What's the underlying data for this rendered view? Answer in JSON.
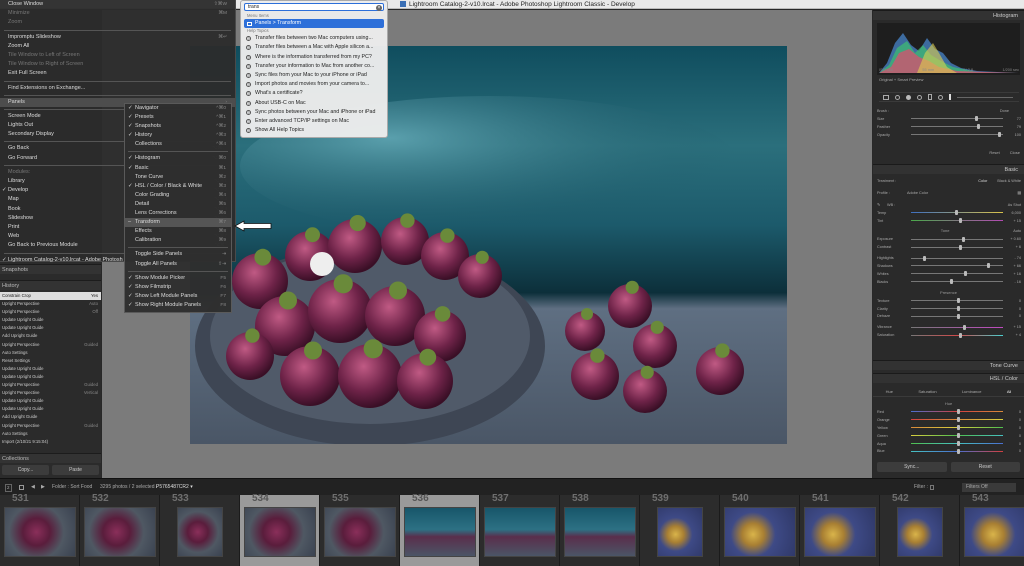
{
  "window": {
    "title": "Lightroom Catalog-2-v10.lrcat - Adobe Photoshop Lightroom Classic - Develop"
  },
  "colors": {
    "accent": "#2d6fd9",
    "panel": "#2b2b2b",
    "selected_row": "#dcdcdc"
  },
  "menu": {
    "items": [
      {
        "label": "Close Window",
        "shortcut": "⇧⌘W",
        "disabled": false
      },
      {
        "label": "Minimize",
        "shortcut": "⌘M",
        "disabled": true
      },
      {
        "label": "Zoom",
        "shortcut": "",
        "disabled": true
      },
      {
        "sep": true
      },
      {
        "label": "Impromptu Slideshow",
        "shortcut": "⌘↵",
        "disabled": false
      },
      {
        "label": "Zoom All",
        "shortcut": "",
        "disabled": false
      },
      {
        "label": "Tile Window to Left of Screen",
        "shortcut": "",
        "disabled": true
      },
      {
        "label": "Tile Window to Right of Screen",
        "shortcut": "",
        "disabled": true
      },
      {
        "label": "Exit Full Screen",
        "shortcut": "",
        "disabled": false
      },
      {
        "sep": true
      },
      {
        "label": "Find Extensions on Exchange...",
        "shortcut": "",
        "disabled": false
      },
      {
        "sep": true
      },
      {
        "label": "Panels",
        "shortcut": "›",
        "disabled": false,
        "highlight": true
      },
      {
        "sep": true
      },
      {
        "label": "Screen Mode",
        "shortcut": "›",
        "disabled": false
      },
      {
        "label": "Lights Out",
        "shortcut": "›",
        "disabled": false
      },
      {
        "label": "Secondary Display",
        "shortcut": "›",
        "disabled": false
      },
      {
        "sep": true
      },
      {
        "label": "Go Back",
        "shortcut": "⌥⌘←",
        "disabled": false
      },
      {
        "label": "Go Forward",
        "shortcut": "⌥⌘→",
        "disabled": false
      },
      {
        "sep": true
      },
      {
        "label": "Modules:",
        "shortcut": "",
        "disabled": true
      },
      {
        "label": "Library",
        "shortcut": "⌥⌘1",
        "disabled": false
      },
      {
        "label": "Develop",
        "shortcut": "⌥⌘2",
        "disabled": false,
        "check": true
      },
      {
        "label": "Map",
        "shortcut": "⌥⌘3",
        "disabled": false
      },
      {
        "label": "Book",
        "shortcut": "⌥⌘4",
        "disabled": false
      },
      {
        "label": "Slideshow",
        "shortcut": "⌥⌘5",
        "disabled": false
      },
      {
        "label": "Print",
        "shortcut": "⌥⌘6",
        "disabled": false
      },
      {
        "label": "Web",
        "shortcut": "⌥⌘7",
        "disabled": false
      },
      {
        "label": "Go Back to Previous Module",
        "shortcut": "⌥⌘↑",
        "disabled": false
      },
      {
        "sep": true
      },
      {
        "label": "Lightroom Catalog-2-v10.lrcat - Adobe Photosh",
        "shortcut": "",
        "disabled": false,
        "check": true
      }
    ]
  },
  "submenu": {
    "items": [
      {
        "label": "Navigator",
        "shortcut": "^⌘0",
        "check": true
      },
      {
        "label": "Presets",
        "shortcut": "^⌘1",
        "check": true
      },
      {
        "label": "Snapshots",
        "shortcut": "^⌘2",
        "check": true
      },
      {
        "label": "History",
        "shortcut": "^⌘3",
        "check": true
      },
      {
        "label": "Collections",
        "shortcut": "^⌘4",
        "check": false
      },
      {
        "sep": true
      },
      {
        "label": "Histogram",
        "shortcut": "⌘0",
        "check": true
      },
      {
        "label": "Basic",
        "shortcut": "⌘1",
        "check": true
      },
      {
        "label": "Tone Curve",
        "shortcut": "⌘2",
        "check": false
      },
      {
        "label": "HSL / Color / Black & White",
        "shortcut": "⌘3",
        "check": true
      },
      {
        "label": "Color Grading",
        "shortcut": "⌘4",
        "check": false
      },
      {
        "label": "Detail",
        "shortcut": "⌘5",
        "check": false
      },
      {
        "label": "Lens Corrections",
        "shortcut": "⌘6",
        "check": false
      },
      {
        "label": "Transform",
        "shortcut": "⌘7",
        "check": false,
        "dash": true,
        "highlight": true
      },
      {
        "label": "Effects",
        "shortcut": "⌘8",
        "check": false
      },
      {
        "label": "Calibration",
        "shortcut": "⌘9",
        "check": false
      },
      {
        "sep": true
      },
      {
        "label": "Toggle Side Panels",
        "shortcut": "⇥",
        "check": false
      },
      {
        "label": "Toggle All Panels",
        "shortcut": "⇧⇥",
        "check": false
      },
      {
        "sep": true
      },
      {
        "label": "Show Module Picker",
        "shortcut": "F5",
        "check": true
      },
      {
        "label": "Show Filmstrip",
        "shortcut": "F6",
        "check": true
      },
      {
        "label": "Show Left Module Panels",
        "shortcut": "F7",
        "check": true
      },
      {
        "label": "Show Right Module Panels",
        "shortcut": "F8",
        "check": true
      }
    ]
  },
  "help": {
    "query": "trans",
    "menu_items_label": "Menu Items",
    "menu_result": "Panels > Transform",
    "help_topics_label": "Help Topics",
    "topics": [
      "Transfer files between two Mac computers using...",
      "Transfer files between a Mac with Apple silicon a...",
      "Where is the information transferred from my PC?",
      "Transfer your information to Mac from another co...",
      "Sync files from your Mac to your iPhone or iPad",
      "Import photos and movies from your camera to...",
      "What's a certificate?",
      "About USB-C on Mac",
      "Sync photos between your Mac and iPhone or iPad",
      "Enter advanced TCP/IP settings on Mac",
      "Show All Help Topics"
    ]
  },
  "left_panel": {
    "snapshots": "Snapshots",
    "history": "History",
    "collections": "Collections",
    "copy": "Copy...",
    "paste": "Paste",
    "history_items": [
      {
        "label": "Constrain Crop",
        "value": "Yes",
        "sel": true
      },
      {
        "label": "Upright Perspective",
        "value": "Auto"
      },
      {
        "label": "Upright Perspective",
        "value": "Off"
      },
      {
        "label": "Update Upright Guide",
        "value": ""
      },
      {
        "label": "Update Upright Guide",
        "value": ""
      },
      {
        "label": "Add Upright Guide",
        "value": ""
      },
      {
        "label": "Upright Perspective",
        "value": "Guided"
      },
      {
        "label": "Auto Settings",
        "value": ""
      },
      {
        "label": "Reset Settings",
        "value": ""
      },
      {
        "label": "Update Upright Guide",
        "value": ""
      },
      {
        "label": "Update Upright Guide",
        "value": ""
      },
      {
        "label": "Upright Perspective",
        "value": "Guided"
      },
      {
        "label": "Upright Perspective",
        "value": "Vertical"
      },
      {
        "label": "Update Upright Guide",
        "value": ""
      },
      {
        "label": "Update Upright Guide",
        "value": ""
      },
      {
        "label": "Add Upright Guide",
        "value": ""
      },
      {
        "label": "Upright Perspective",
        "value": "Guided"
      },
      {
        "label": "Auto Settings",
        "value": ""
      },
      {
        "label": "Import (2/10/21 9:15:04)",
        "value": ""
      }
    ]
  },
  "right_panel": {
    "histogram": "Histogram",
    "hist_readout": [
      "ISO 400",
      "55 mm",
      "f / 2.8",
      "1/200 sec"
    ],
    "original_smart": "Original + Smart Preview",
    "brush": "Brush :",
    "done": "Done",
    "size": "Size",
    "feather": "Feather",
    "opacity": "Opacity",
    "size_v": "77",
    "feather_v": "79",
    "opacity_v": "100",
    "reset": "Reset",
    "close": "Close",
    "basic": "Basic",
    "treatment": "Treatment :",
    "color": "Color",
    "bw": "Black & White",
    "profile": "Profile :",
    "adobe_color": "Adobe Color",
    "wb": "WB :",
    "as_shot": "As Shot",
    "temp": "Temp",
    "temp_v": "6,000",
    "tint": "Tint",
    "tint_v": "+ 15",
    "tone": "Tone",
    "auto": "Auto",
    "exposure": "Exposure",
    "exposure_v": "+ 0.60",
    "contrast": "Contrast",
    "contrast_v": "+ 6",
    "highlights": "Highlights",
    "highlights_v": "- 74",
    "shadows": "Shadows",
    "shadows_v": "+ 66",
    "whites": "Whites",
    "whites_v": "+ 16",
    "blacks": "Blacks",
    "blacks_v": "- 16",
    "presence": "Presence",
    "texture": "Texture",
    "texture_v": "0",
    "clarity": "Clarity",
    "clarity_v": "0",
    "dehaze": "Dehaze",
    "dehaze_v": "0",
    "vibrance": "Vibrance",
    "vibrance_v": "+ 15",
    "saturation": "Saturation",
    "saturation_v": "+ 4",
    "tone_curve": "Tone Curve",
    "hsl": "HSL / Color",
    "hue_tab": "Hue",
    "sat_tab": "Saturation",
    "lum_tab": "Luminance",
    "all_tab": "All",
    "hue_label": "Hue",
    "hue_rows": [
      {
        "label": "Red",
        "v": "0"
      },
      {
        "label": "Orange",
        "v": "0"
      },
      {
        "label": "Yellow",
        "v": "0"
      },
      {
        "label": "Green",
        "v": "0"
      },
      {
        "label": "Aqua",
        "v": "0"
      },
      {
        "label": "Blue",
        "v": "0"
      }
    ],
    "sync": "Sync...",
    "reset_btn": "Reset"
  },
  "filmstrip": {
    "folder": "Folder : Sort Food",
    "count": "3295 photos / 2 selected /",
    "file": "P5765487CR2 ▾",
    "filter": "Filter :",
    "filters_off": "Filters Off",
    "panel_label": "2",
    "cells": [
      {
        "num": "531",
        "kind": "fruit"
      },
      {
        "num": "532",
        "kind": "fruit"
      },
      {
        "num": "533",
        "kind": "fruit"
      },
      {
        "num": "534",
        "kind": "fruit",
        "sel": true
      },
      {
        "num": "535",
        "kind": "fruit"
      },
      {
        "num": "536",
        "kind": "teal",
        "sel": true
      },
      {
        "num": "537",
        "kind": "teal"
      },
      {
        "num": "538",
        "kind": "teal"
      },
      {
        "num": "539",
        "kind": "banana"
      },
      {
        "num": "540",
        "kind": "banana"
      },
      {
        "num": "541",
        "kind": "banana"
      },
      {
        "num": "542",
        "kind": "banana"
      },
      {
        "num": "543",
        "kind": "banana"
      }
    ]
  }
}
